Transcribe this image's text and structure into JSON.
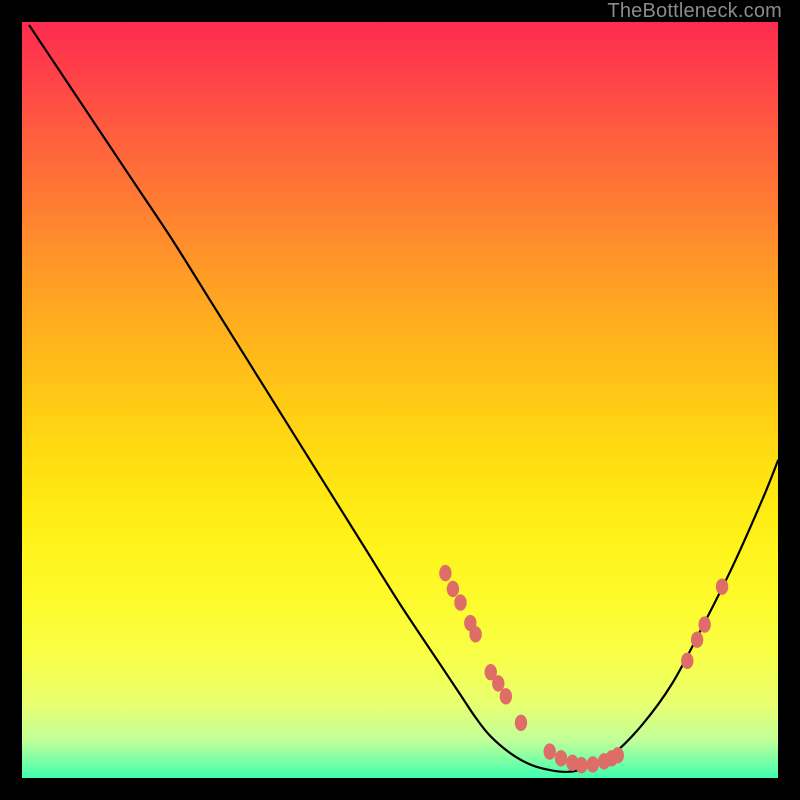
{
  "attribution": "TheBottleneck.com",
  "colors": {
    "background_frame": "#000000",
    "curve_stroke": "#010101",
    "marker_fill": "#de6d68",
    "gradient_top": "#fe2b4f",
    "gradient_bottom": "#40ffb0"
  },
  "chart_data": {
    "type": "line",
    "title": "",
    "subtitle": "",
    "xlabel": "",
    "ylabel": "",
    "xlim": [
      0,
      100
    ],
    "ylim": [
      0,
      100
    ],
    "grid": false,
    "legend_position": "none",
    "description": "Single unlabeled bottleneck curve on a vertical red-to-green gradient; minimum (green zone) denotes the optimal match. Curve values are estimated from the plot.",
    "series": [
      {
        "name": "bottleneck-curve",
        "x": [
          1,
          5,
          10,
          15,
          20,
          25,
          30,
          35,
          40,
          45,
          50,
          55,
          58,
          60,
          62,
          65,
          68,
          72,
          75,
          78,
          82,
          86,
          90,
          94,
          98,
          100
        ],
        "y": [
          99.5,
          93.5,
          86,
          78.5,
          71,
          63,
          55,
          47,
          39,
          31,
          23,
          15.5,
          11,
          8,
          5.5,
          3,
          1.5,
          0.8,
          1.5,
          3,
          7,
          12.5,
          20,
          28,
          37,
          42
        ]
      }
    ],
    "markers": [
      {
        "x": 56.0,
        "y": 27.1
      },
      {
        "x": 57.0,
        "y": 25.0
      },
      {
        "x": 58.0,
        "y": 23.2
      },
      {
        "x": 59.3,
        "y": 20.5
      },
      {
        "x": 60.0,
        "y": 19.0
      },
      {
        "x": 62.0,
        "y": 14.0
      },
      {
        "x": 63.0,
        "y": 12.5
      },
      {
        "x": 64.0,
        "y": 10.8
      },
      {
        "x": 66.0,
        "y": 7.3
      },
      {
        "x": 69.8,
        "y": 3.5
      },
      {
        "x": 71.3,
        "y": 2.6
      },
      {
        "x": 72.8,
        "y": 2.0
      },
      {
        "x": 74.0,
        "y": 1.7
      },
      {
        "x": 75.5,
        "y": 1.8
      },
      {
        "x": 77.0,
        "y": 2.2
      },
      {
        "x": 78.0,
        "y": 2.6
      },
      {
        "x": 78.8,
        "y": 3.0
      },
      {
        "x": 88.0,
        "y": 15.5
      },
      {
        "x": 89.3,
        "y": 18.3
      },
      {
        "x": 90.3,
        "y": 20.3
      },
      {
        "x": 92.6,
        "y": 25.3
      }
    ]
  }
}
